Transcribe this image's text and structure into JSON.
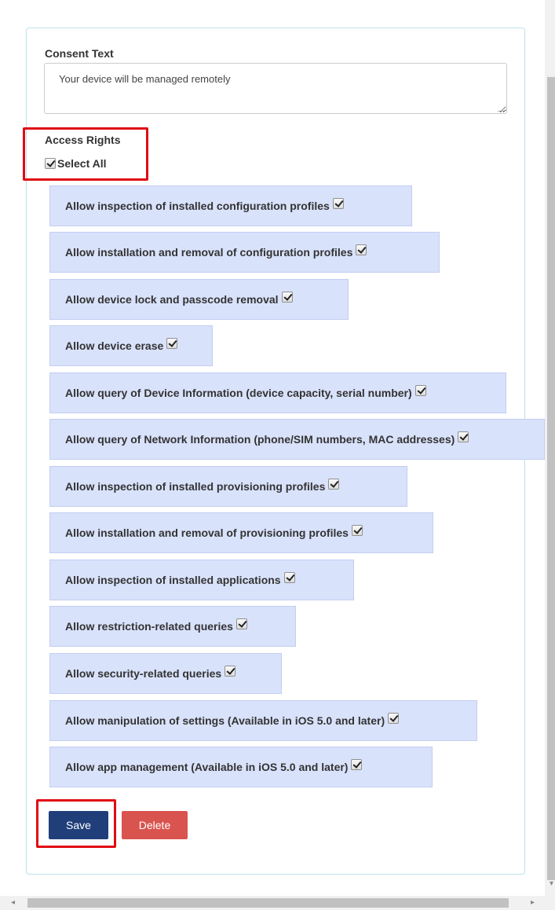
{
  "consent": {
    "label": "Consent Text",
    "value": "Your device will be managed remotely"
  },
  "access": {
    "label": "Access Rights",
    "select_all_label": "Select All",
    "select_all_checked": true,
    "rights": [
      {
        "label": "Allow inspection of installed configuration profiles",
        "checked": true
      },
      {
        "label": "Allow installation and removal of configuration profiles",
        "checked": true
      },
      {
        "label": "Allow device lock and passcode removal",
        "checked": true
      },
      {
        "label": "Allow device erase",
        "checked": true
      },
      {
        "label": "Allow query of Device Information (device capacity, serial number)",
        "checked": true
      },
      {
        "label": "Allow query of Network Information (phone/SIM numbers, MAC addresses)",
        "checked": true
      },
      {
        "label": "Allow inspection of installed provisioning profiles",
        "checked": true
      },
      {
        "label": "Allow installation and removal of provisioning profiles",
        "checked": true
      },
      {
        "label": "Allow inspection of installed applications",
        "checked": true
      },
      {
        "label": "Allow restriction-related queries",
        "checked": true
      },
      {
        "label": "Allow security-related queries",
        "checked": true
      },
      {
        "label": "Allow manipulation of settings (Available in iOS 5.0 and later)",
        "checked": true
      },
      {
        "label": "Allow app management (Available in iOS 5.0 and later)",
        "checked": true
      }
    ]
  },
  "actions": {
    "save_label": "Save",
    "delete_label": "Delete"
  },
  "colors": {
    "save": "#203f7a",
    "delete": "#d9534f",
    "highlight": "#e00b14",
    "right_bg": "#d9e2fb"
  }
}
